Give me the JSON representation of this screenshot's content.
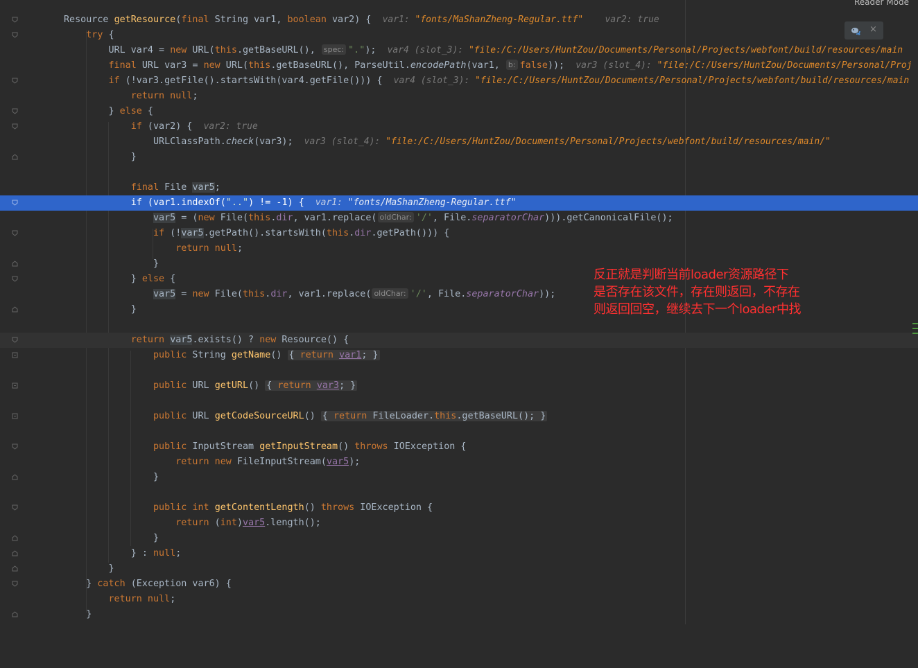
{
  "top_bar": {
    "reader_mode_label": "Reader Mode"
  },
  "debug_toolbar": {
    "icon": "debug-attach-icon",
    "close_glyph": "×"
  },
  "annotation": {
    "line1": "反正就是判断当前loader资源路径下",
    "line2": "是否存在该文件，存在则返回，不存在",
    "line3": "则返回回空，继续去下一个loader中找"
  },
  "colors": {
    "background": "#2b2b2b",
    "exec_line": "#2f65ca",
    "annotation": "#ff3030",
    "keyword": "#cc7832",
    "method": "#ffc66d"
  },
  "hints": {
    "l1_var1": "var1: ",
    "l1_var1_val": "\"fonts/MaShanZheng-Regular.ttf\"",
    "l1_var2": "var2: true",
    "l3_var4": "var4 (slot_3): ",
    "l3_var4_val": "\"file:/C:/Users/HuntZou/Documents/Personal/Projects/webfont/build/resources/main",
    "l4_var3": "var3 (slot_4): ",
    "l4_var3_val": "\"file:/C:/Users/HuntZou/Documents/Personal/Proj",
    "l5_var4": "var4 (slot_3): ",
    "l5_var4_val": "\"file:/C:/Users/HuntZou/Documents/Personal/Projects/webfont/build/resources/main",
    "l8_var2": "var2: true",
    "l9_var3": "var3 (slot_4): ",
    "l9_var3_val": "\"file:/C:/Users/HuntZou/Documents/Personal/Projects/webfont/build/resources/main/\"",
    "l13_var1": "var1: ",
    "l13_var1_val": "\"fonts/MaShanZheng-Regular.ttf\""
  },
  "inlays": {
    "spec": "spec:",
    "b": "b:",
    "oldChar": "oldChar:"
  }
}
